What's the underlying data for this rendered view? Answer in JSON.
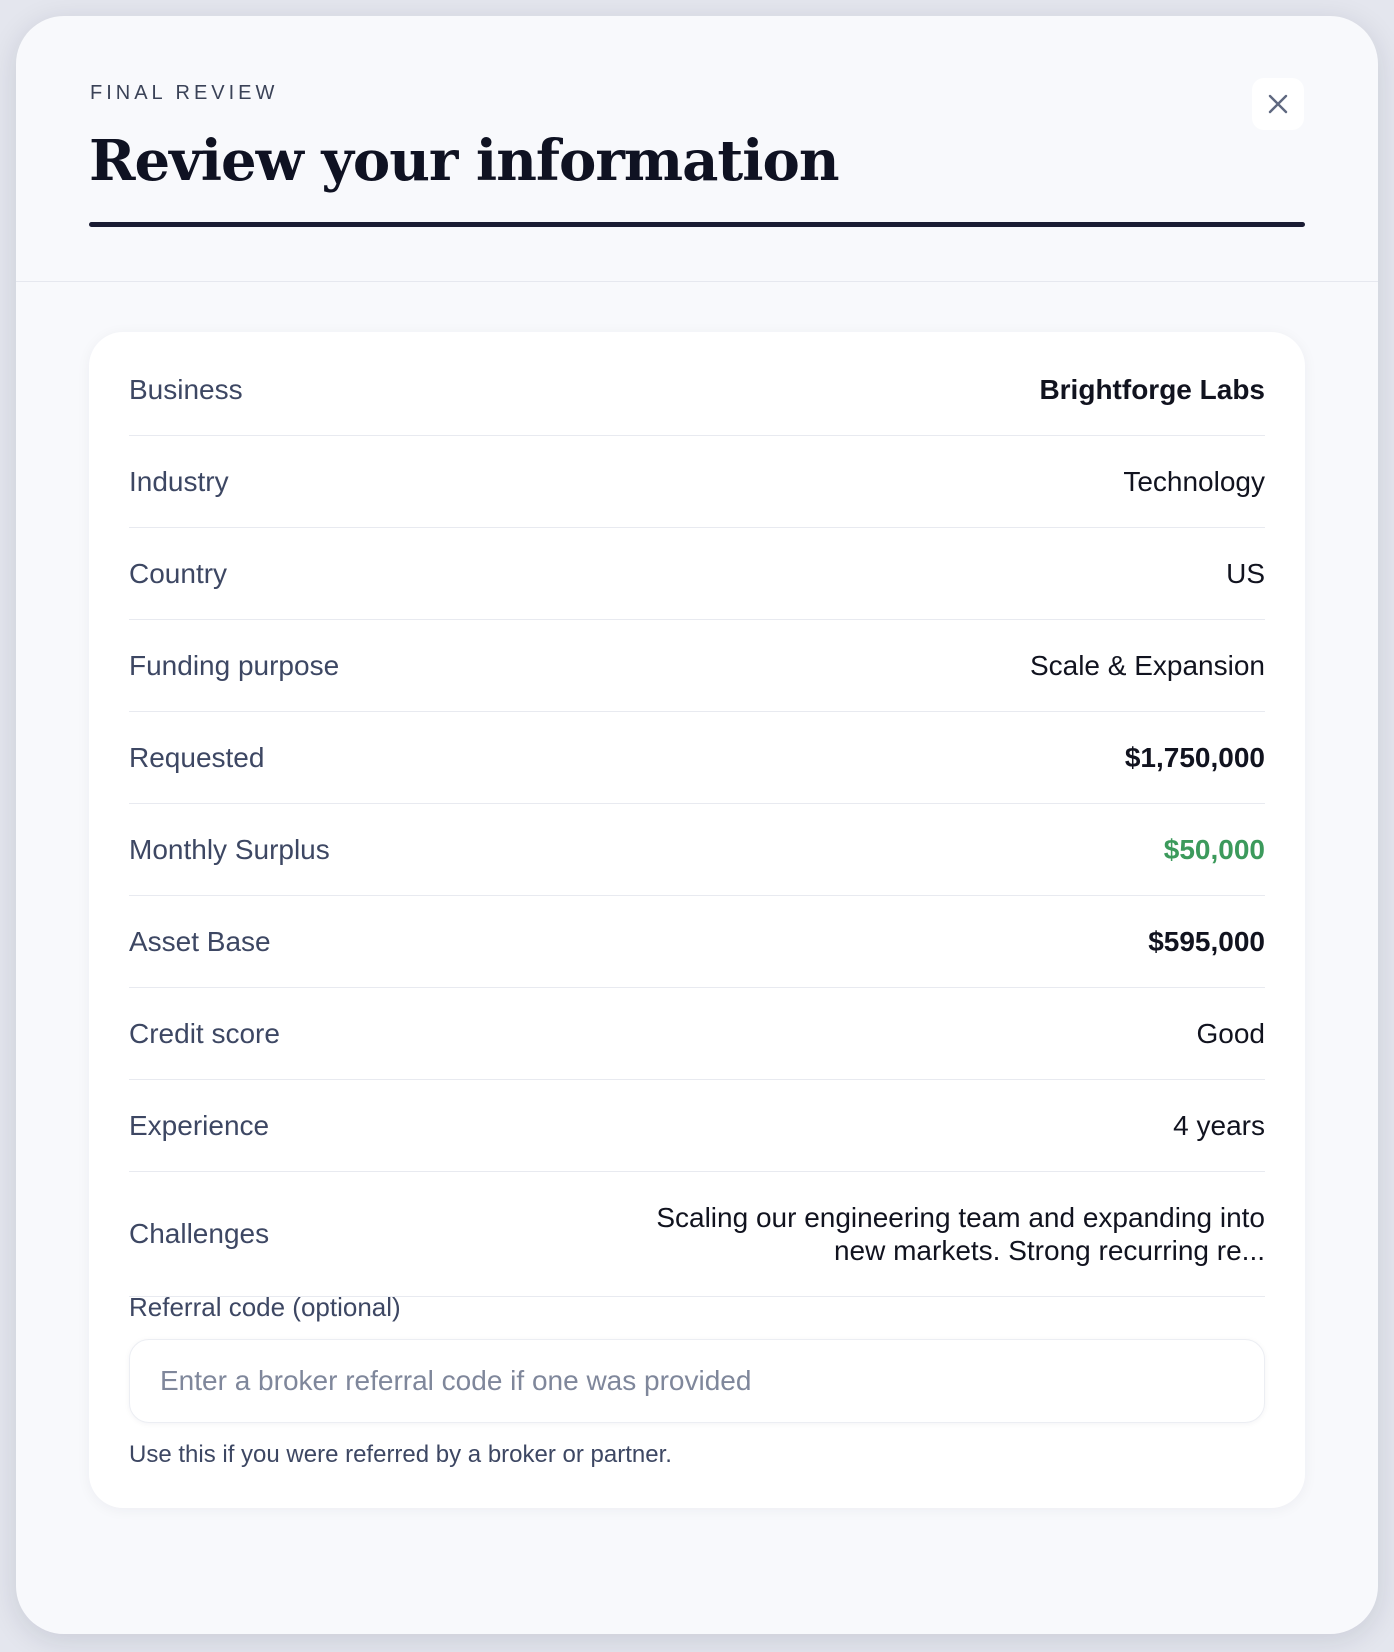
{
  "header": {
    "eyebrow": "FINAL REVIEW",
    "title": "Review your information",
    "close_icon": "close-icon"
  },
  "review": {
    "rows": [
      {
        "label": "Business",
        "value": "Brightforge Labs"
      },
      {
        "label": "Industry",
        "value": "Technology"
      },
      {
        "label": "Country",
        "value": "US"
      },
      {
        "label": "Funding purpose",
        "value": "Scale & Expansion"
      },
      {
        "label": "Requested",
        "value": "$1,750,000"
      },
      {
        "label": "Monthly Surplus",
        "value": "$50,000"
      },
      {
        "label": "Asset Base",
        "value": "$595,000"
      },
      {
        "label": "Credit score",
        "value": "Good"
      },
      {
        "label": "Experience",
        "value": "4 years"
      },
      {
        "label": "Challenges",
        "value": "Scaling our engineering team and expanding into new markets. Strong recurring re..."
      }
    ]
  },
  "referral": {
    "label": "Referral code (optional)",
    "value": "",
    "placeholder": "Enter a broker referral code if one was provided",
    "help": "Use this if you were referred by a broker or partner."
  },
  "colors": {
    "positive_value": "#3c9a5c",
    "title_rule": "#1a1c33"
  }
}
